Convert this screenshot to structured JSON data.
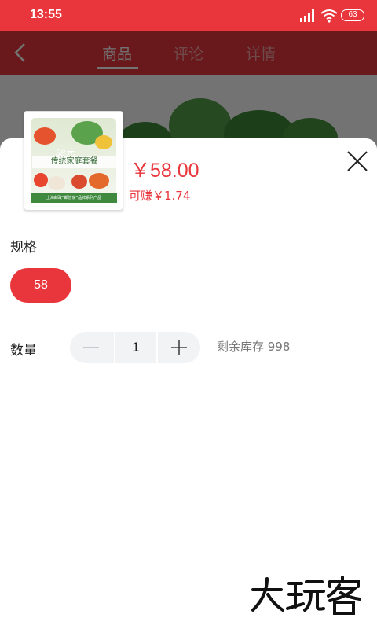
{
  "status_bar": {
    "time": "13:55",
    "battery": "63"
  },
  "nav": {
    "tabs": [
      {
        "label": "商品"
      },
      {
        "label": "评论"
      },
      {
        "label": "详情"
      }
    ]
  },
  "product": {
    "thumbnail_caption": "传统家庭套餐",
    "thumbnail_price": "58元",
    "thumbnail_footer": "上海邮政“邮管家”品牌系列产品",
    "price": "￥58.00",
    "earn": "可赚￥1.74"
  },
  "spec": {
    "label": "规格",
    "options": [
      {
        "label": "58",
        "selected": true
      }
    ]
  },
  "quantity": {
    "label": "数量",
    "value": "1",
    "stock": "剩余库存 998"
  },
  "watermark": "大玩客",
  "colors": {
    "accent": "#e8363c"
  }
}
